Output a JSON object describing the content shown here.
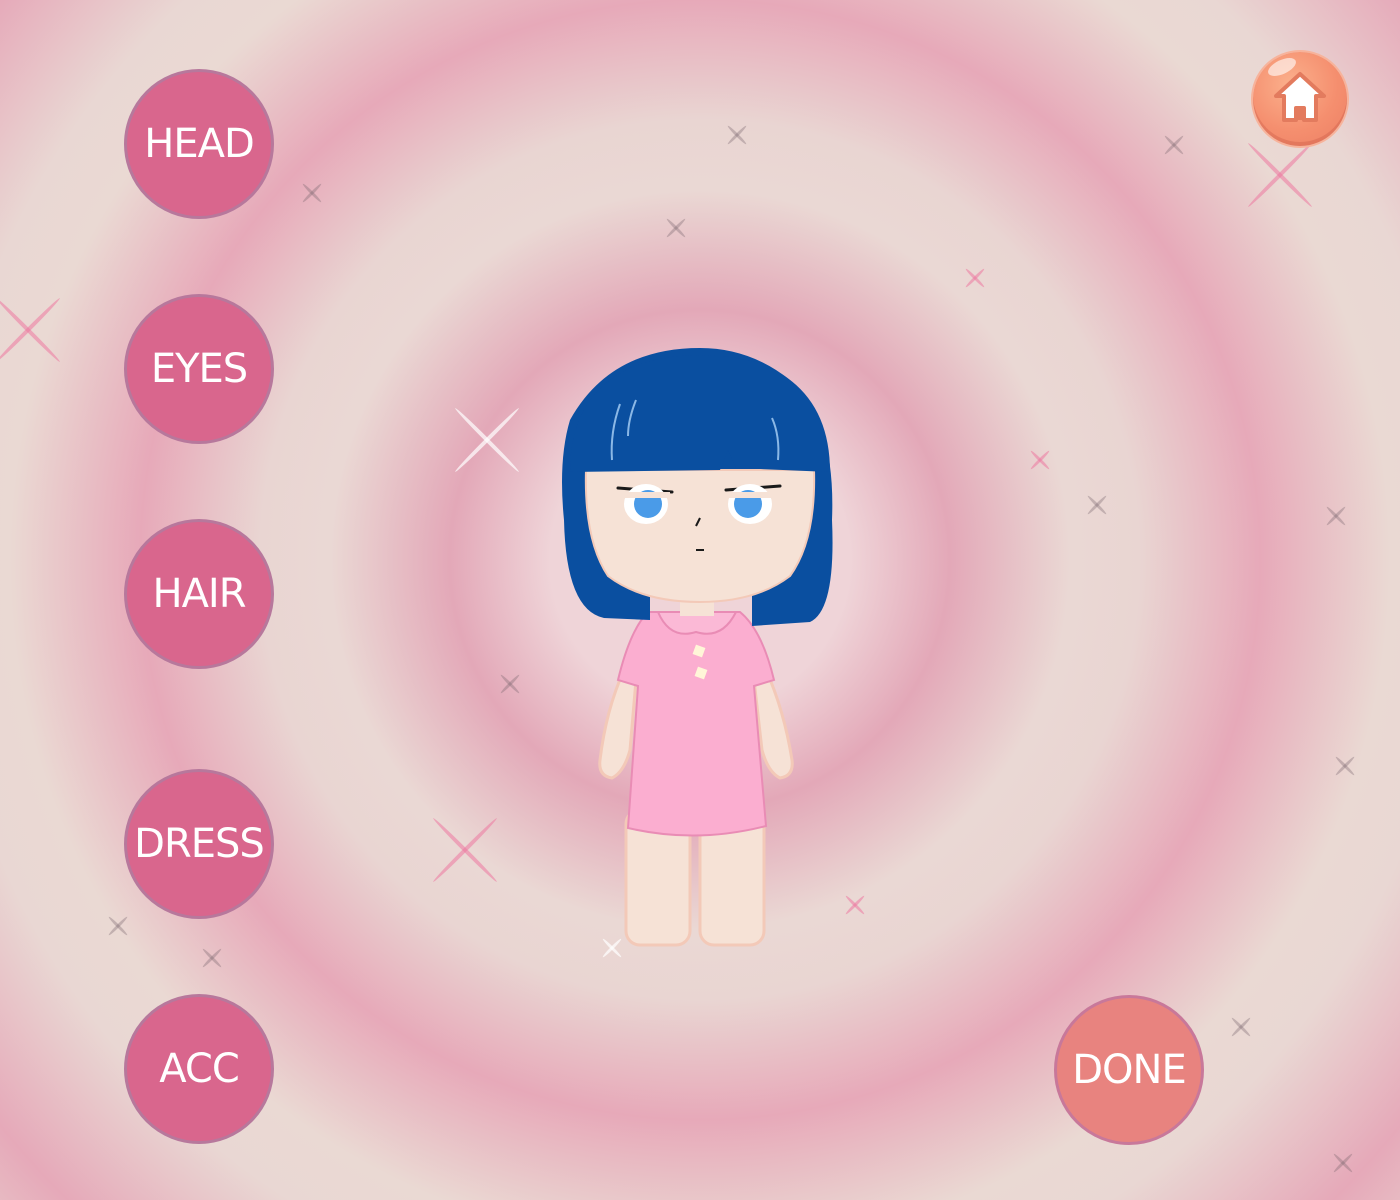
{
  "menu": {
    "head_label": "HEAD",
    "eyes_label": "EYES",
    "hair_label": "HAIR",
    "dress_label": "DRESS",
    "acc_label": "ACC"
  },
  "done_label": "DONE",
  "home_icon": "home-icon",
  "colors": {
    "menu_button": "#d9668d",
    "done_button": "#e8837f",
    "home_button": "#f58f6f",
    "hair": "#0a4fa0",
    "dress": "#fbaed0",
    "skin": "#f6e2d6",
    "eyes": "#4a9be8"
  }
}
